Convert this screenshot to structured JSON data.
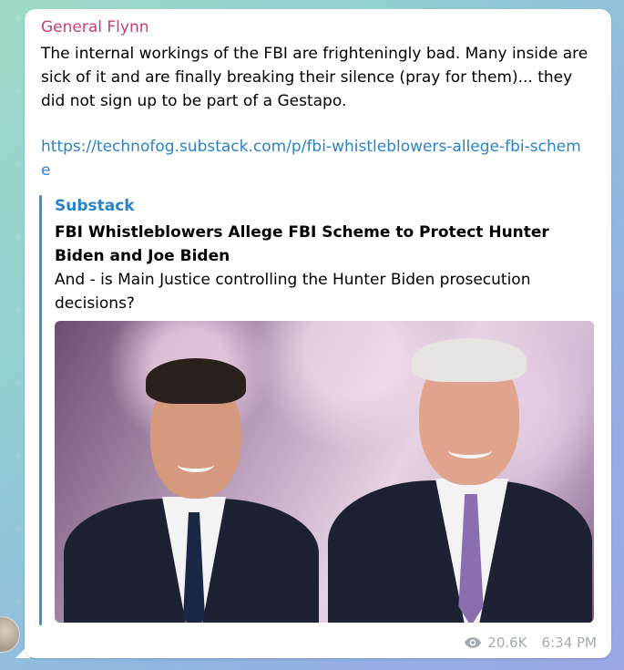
{
  "message": {
    "sender": "General Flynn",
    "text": "The internal workings of the FBI are frighteningly bad. Many inside are sick of it and are finally breaking their silence (pray for them)... they did not sign up to be part of a Gestapo.",
    "link": "https://technofog.substack.com/p/fbi-whistleblowers-allege-fbi-scheme",
    "views": "20.6K",
    "time": "6:34 PM"
  },
  "preview": {
    "site_name": "Substack",
    "title": "FBI Whistleblowers Allege FBI Scheme to Protect Hunter Biden and Joe Biden",
    "description": "And - is Main Justice controlling the Hunter Biden prosecution decisions?"
  },
  "colors": {
    "sender": "#c8416a",
    "link": "#2a83c4",
    "accent_bar": "#3a90d0",
    "meta": "#a2acb4"
  },
  "icons": {
    "views": "eye-icon"
  }
}
